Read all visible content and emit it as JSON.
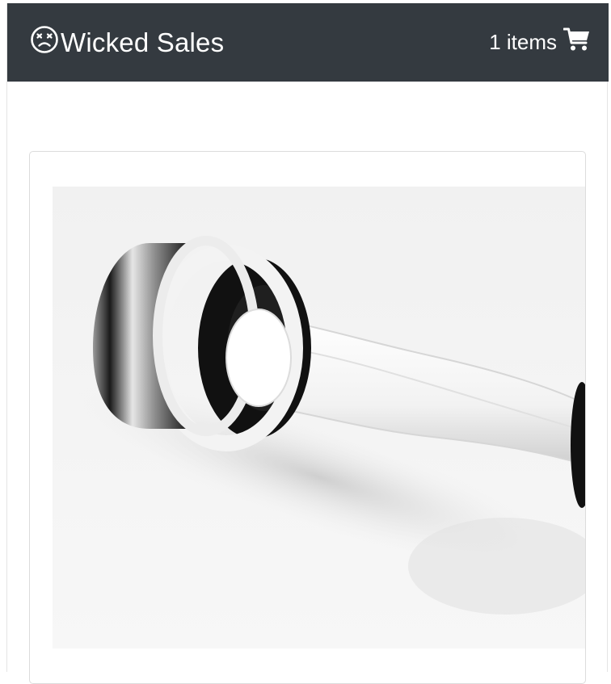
{
  "navbar": {
    "brand_icon": "dizzy-face-icon",
    "brand_name": "Wicked Sales",
    "cart_count": "1 items",
    "cart_icon": "shopping-cart-icon"
  },
  "product": {
    "image_alt": "Shake weight dumbbell",
    "image_icon": "product-photo"
  }
}
